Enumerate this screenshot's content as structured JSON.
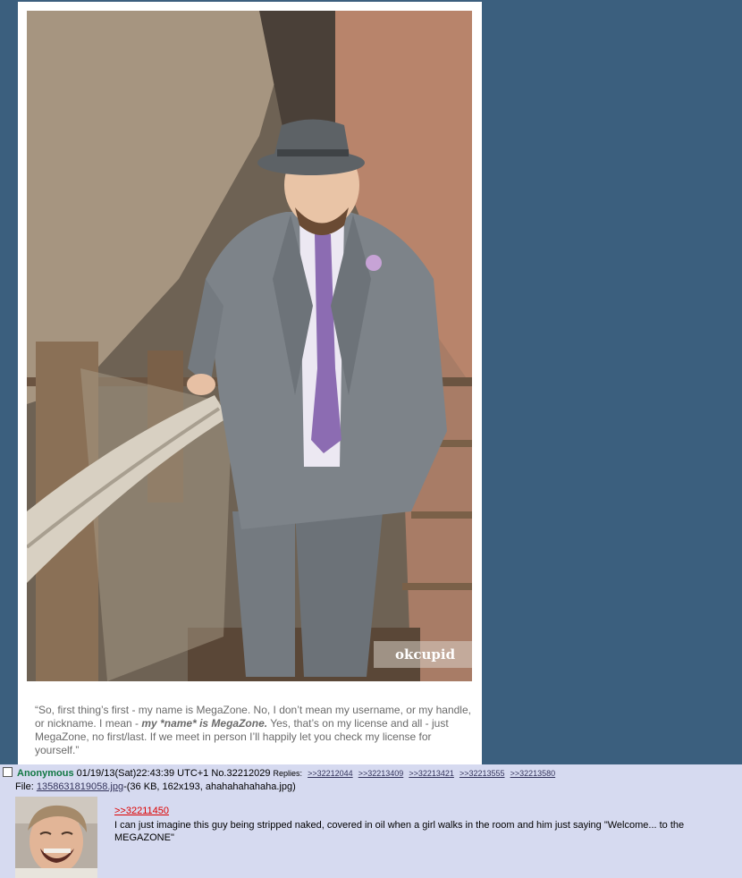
{
  "image_post": {
    "watermark": "okcupid",
    "caption": {
      "part1": "“So, first thing’s first - my name is MegaZone. No, I don’t mean my username, or my handle, or nickname. I mean - ",
      "emphasis": "my *name* is MegaZone.",
      "part2": " Yes, that’s on my license and all - just MegaZone, no first/last. If we meet in person I’ll happily let you check my license for yourself.”"
    }
  },
  "reply_post": {
    "name": "Anonymous",
    "datetime": "01/19/13(Sat)22:43:39 UTC+1",
    "post_no": "No.32212029",
    "replies_label": "Replies:",
    "replies": [
      ">>32212044",
      ">>32213409",
      ">>32213421",
      ">>32213555",
      ">>32213580"
    ],
    "file_prefix": "File: ",
    "file_name": "1358631819058.jpg",
    "file_info": "-(36 KB, 162x193, ahahahahahaha.jpg)",
    "quote_link": ">>32211450",
    "comment": "I can just imagine this guy being stripped naked, covered in oil when a girl walks in the room and him just saying \"Welcome... to the MEGAZONE\""
  },
  "colors": {
    "page_background": "#3b5f7e",
    "post_background": "#d6daf0",
    "name_green": "#117743",
    "link_blue": "#34345c",
    "quote_red": "#dd0000"
  }
}
